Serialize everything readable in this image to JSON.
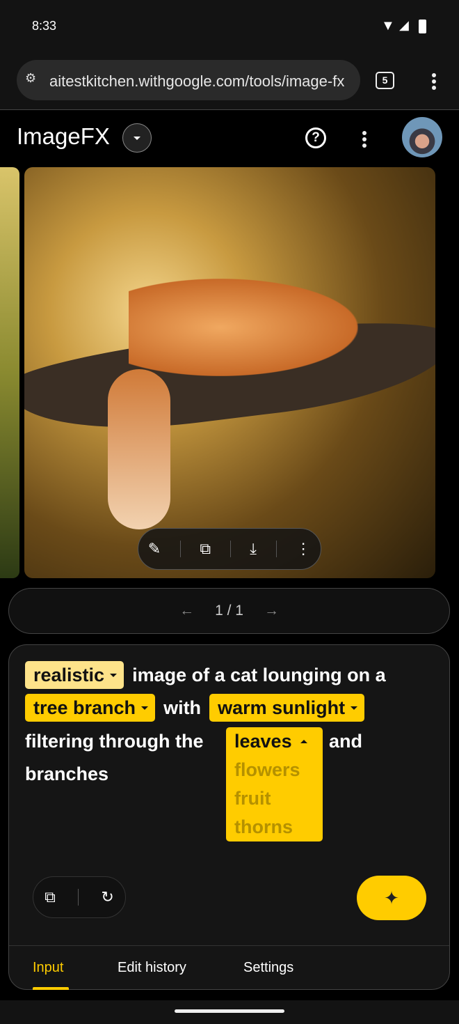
{
  "status_bar": {
    "time": "8:33",
    "icons": [
      "wifi-icon",
      "signal-icon",
      "battery-icon"
    ]
  },
  "browser": {
    "url": "aitestkitchen.withgoogle.com/tools/image-fx",
    "tab_count": "5"
  },
  "app": {
    "title": "ImageFX"
  },
  "image_toolbar": {
    "icons": [
      "edit-icon",
      "copy-icon",
      "download-icon",
      "more-icon"
    ]
  },
  "pager": {
    "label": "1 / 1"
  },
  "prompt": {
    "chip1": "realistic",
    "text1": "image of a cat lounging on a",
    "chip2": "tree branch",
    "text2": "with",
    "chip3": "warm sunlight",
    "text3": "filtering through the",
    "chip4": "leaves",
    "text4": "and",
    "text5": "branches",
    "dropdown_options": [
      "flowers",
      "fruit",
      "thorns"
    ]
  },
  "tabs": [
    {
      "label": "Input",
      "active": true
    },
    {
      "label": "Edit history"
    },
    {
      "label": "Settings"
    }
  ],
  "colors": {
    "accent": "#ffcc00",
    "chip_light": "#fee38a"
  }
}
